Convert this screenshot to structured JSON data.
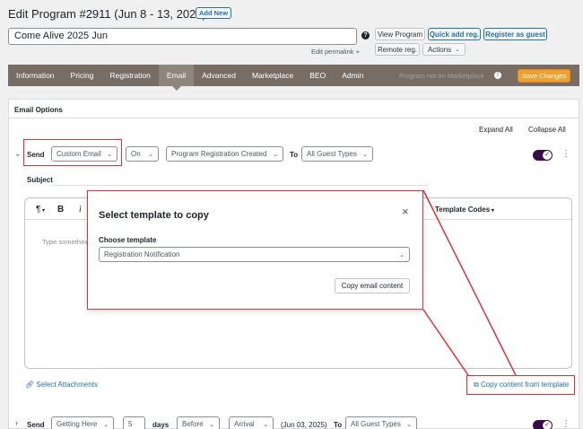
{
  "page": {
    "title": "Edit Program #2911 (Jun 8 - 13, 2025)",
    "add_new": "Add New",
    "program_name": "Come Alive 2025 Jun",
    "edit_permalink": "Edit permalink +",
    "actions": {
      "view_program": "View Program",
      "quick_add": "Quick add reg.",
      "register_guest": "Register as guest",
      "remote_reg": "Remote reg.",
      "actions_label": "Actions"
    }
  },
  "tabs": [
    "Information",
    "Pricing",
    "Registration",
    "Email",
    "Advanced",
    "Marketplace",
    "BEO",
    "Admin"
  ],
  "tabs_right": {
    "marketplace_status": "Program not on Marketplace",
    "save": "Save Changes"
  },
  "email_options": {
    "heading": "Email Options",
    "expand_all": "Expand All",
    "collapse_all": "Collapse All",
    "row1": {
      "send": "Send",
      "type": "Custom Email",
      "on": "On",
      "trigger": "Program Registration Created",
      "to": "To",
      "guests": "All Guest Types"
    },
    "subject_label": "Subject",
    "editor": {
      "paragraph": "¶",
      "bold": "B",
      "italic": "i",
      "placeholder": "Type something",
      "template_codes": "Template Codes"
    },
    "select_attachments": "Select Attachments",
    "copy_from_template": "Copy content from template",
    "row2": {
      "send": "Send",
      "type": "Getting Here",
      "days_value": "5",
      "days": "days",
      "before": "Before",
      "arrival": "Arrival",
      "date": "(Jun 03, 2025)",
      "to": "To",
      "guests": "All Guest Types"
    }
  },
  "modal": {
    "title": "Select template to copy",
    "close": "×",
    "choose_label": "Choose template",
    "selected": "Registration Notification",
    "copy_button": "Copy email content"
  },
  "colors": {
    "tab_bar": "#776d64",
    "save": "#f0a030",
    "highlight": "#e0303a",
    "link": "#2271b1",
    "toggle": "#3a0b4a"
  }
}
